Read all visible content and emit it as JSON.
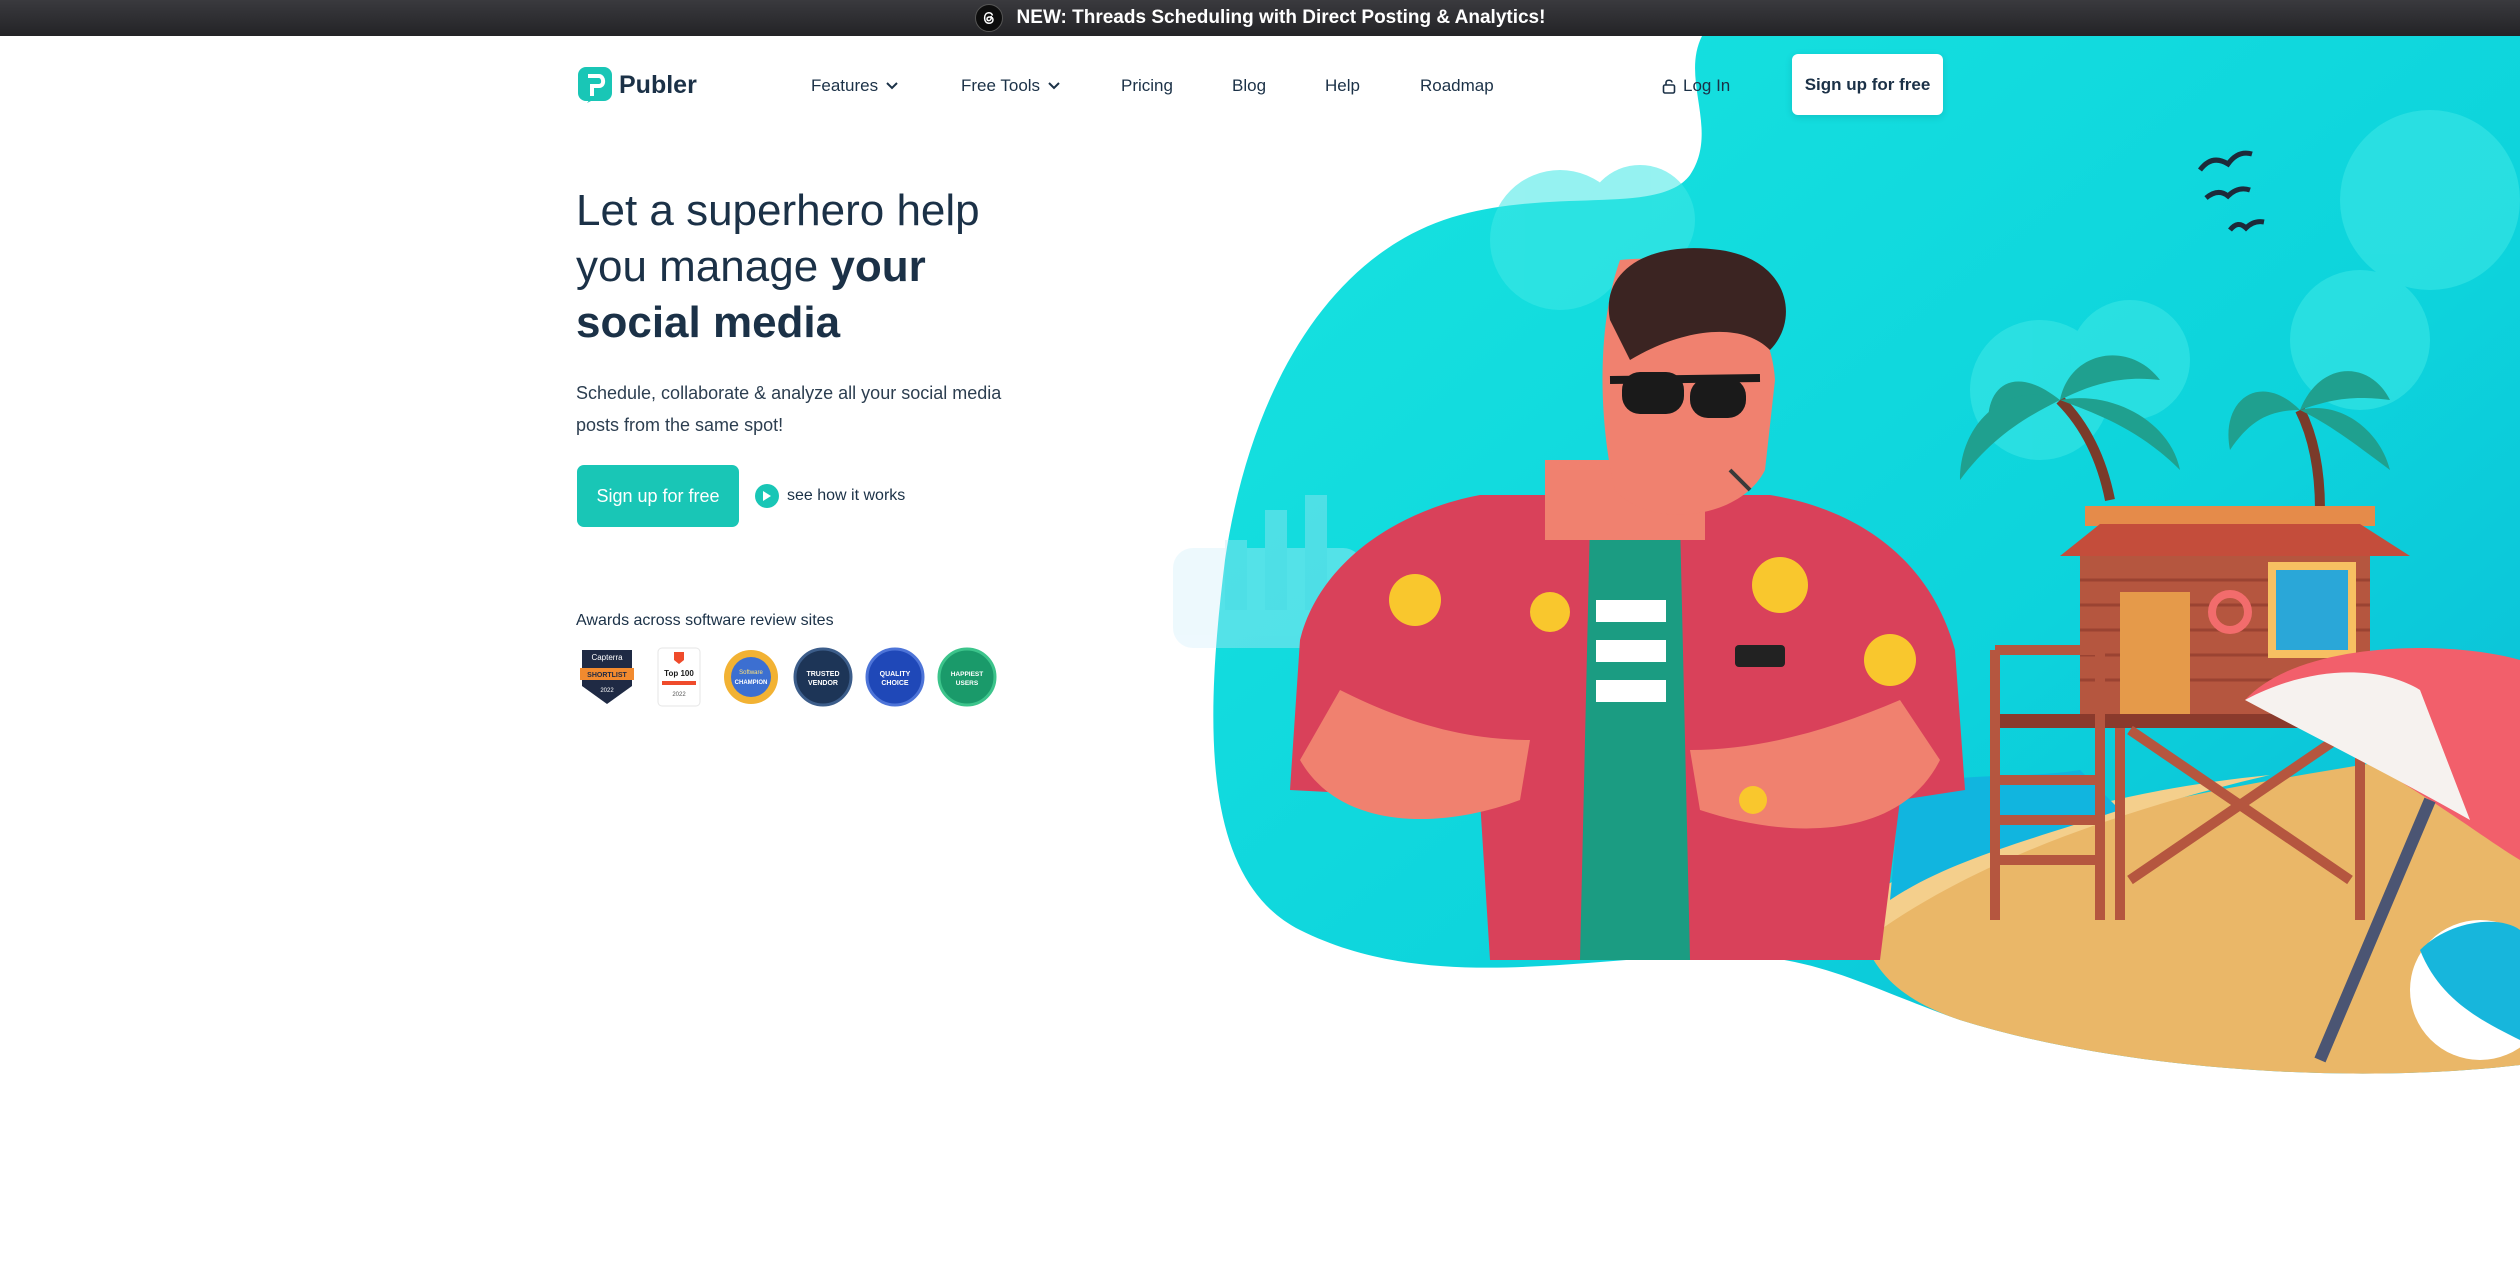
{
  "announcement": {
    "text": "NEW: Threads Scheduling with Direct Posting & Analytics!"
  },
  "brand": {
    "name": "Publer",
    "accent": "#19c6b6",
    "navy": "#1b3147"
  },
  "nav": {
    "items": [
      {
        "label": "Features",
        "has_dropdown": true
      },
      {
        "label": "Free Tools",
        "has_dropdown": true
      },
      {
        "label": "Pricing",
        "has_dropdown": false
      },
      {
        "label": "Blog",
        "has_dropdown": false
      },
      {
        "label": "Help",
        "has_dropdown": false
      },
      {
        "label": "Roadmap",
        "has_dropdown": false
      }
    ],
    "login_label": "Log In",
    "signup_label": "Sign up for free"
  },
  "hero": {
    "headline_1": "Let a superhero help you manage",
    "headline_2": "your social media",
    "subtext": "Schedule, collaborate & analyze all your social media posts from the same spot!",
    "cta_label": "Sign up for free",
    "watch_label": "see how it works",
    "awards_label": "Awards across software review sites",
    "badges": [
      {
        "name": "capterra-shortlist-badge",
        "lines": [
          "Capterra",
          "SHORTLIST",
          "2022"
        ]
      },
      {
        "name": "g2-top100-badge",
        "lines": [
          "Top 100",
          "2022"
        ]
      },
      {
        "name": "software-suggest-champion-badge",
        "lines": [
          "Software",
          "CHAMPION"
        ]
      },
      {
        "name": "trusted-vendor-badge",
        "lines": [
          "TRUSTED",
          "VENDOR"
        ]
      },
      {
        "name": "quality-choice-badge",
        "lines": [
          "QUALITY",
          "CHOICE"
        ]
      },
      {
        "name": "happiest-users-badge",
        "lines": [
          "HAPPIEST",
          "USERS"
        ]
      }
    ]
  }
}
